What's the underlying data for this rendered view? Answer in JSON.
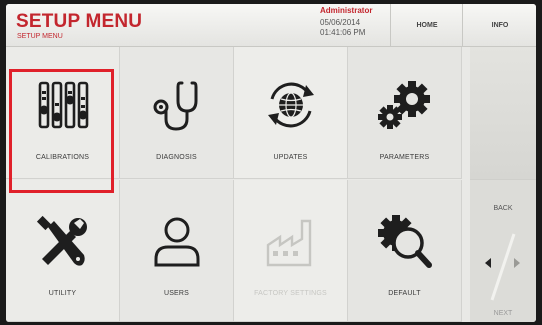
{
  "header": {
    "title": "SETUP MENU",
    "subtitle": "SETUP MENU",
    "user": {
      "role": "Administrator",
      "date": "05/06/2014",
      "time": "01:41:06 PM"
    },
    "home_label": "HOME",
    "info_label": "INFO"
  },
  "tiles": [
    {
      "label": "CALIBRATIONS",
      "icon": "sliders-icon",
      "selected": true
    },
    {
      "label": "DIAGNOSIS",
      "icon": "stethoscope-icon"
    },
    {
      "label": "UPDATES",
      "icon": "sync-globe-icon"
    },
    {
      "label": "PARAMETERS",
      "icon": "gears-icon"
    },
    {
      "label": "UTILITY",
      "icon": "tools-icon"
    },
    {
      "label": "USERS",
      "icon": "user-icon"
    },
    {
      "label": "FACTORY SETTINGS",
      "icon": "factory-icon",
      "disabled": true
    },
    {
      "label": "DEFAULT",
      "icon": "gear-magnifier-icon"
    }
  ],
  "nav": {
    "back_label": "BACK",
    "next_label": "NEXT"
  },
  "colors": {
    "accent": "#c3262e",
    "selection": "#e0202a",
    "background": "#e9e9e6"
  }
}
